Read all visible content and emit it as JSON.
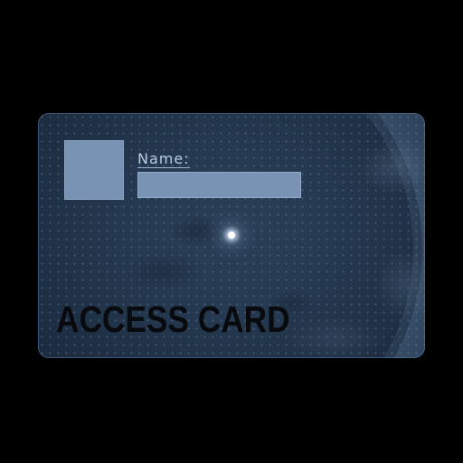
{
  "card": {
    "name_label": "Name:",
    "name_value": "",
    "title": "ACCESS CARD"
  },
  "colors": {
    "background": "#000000",
    "card_base": "#263a52",
    "card_accent": "#7893b4",
    "label_text": "#b8cbe0",
    "title_text": "#080a0d"
  }
}
